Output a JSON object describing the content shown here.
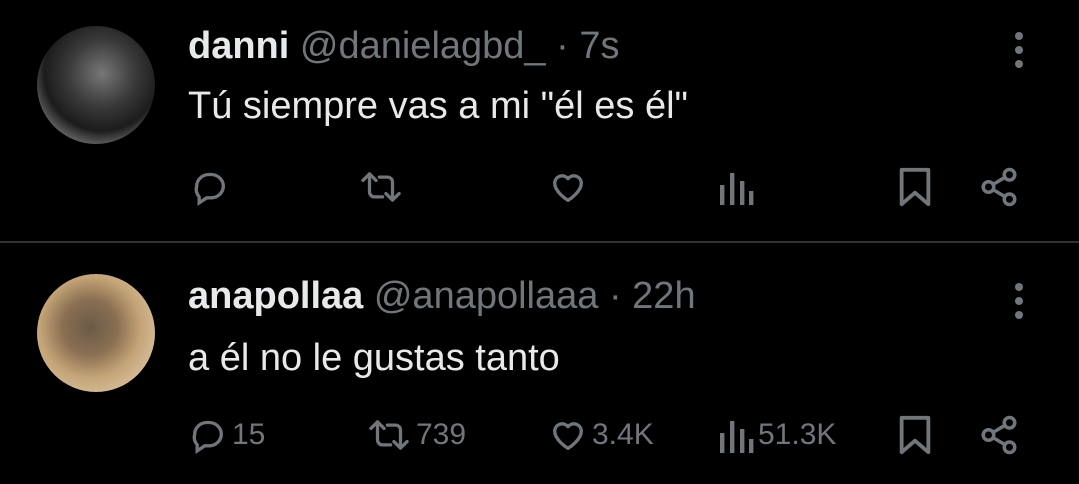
{
  "tweets": [
    {
      "display_name": "danni",
      "handle": "@danielagbd_",
      "separator": "·",
      "time": "7s",
      "text": "Tú siempre vas a mi \"él es él\"",
      "stats": {
        "replies": "",
        "reposts": "",
        "likes": "",
        "views": ""
      },
      "avatar_icon": "profile-photo"
    },
    {
      "display_name": "anapollaa",
      "handle": "@anapollaaa",
      "separator": "·",
      "time": "22h",
      "text": "a él no le gustas tanto",
      "stats": {
        "replies": "15",
        "reposts": "739",
        "likes": "3.4K",
        "views": "51.3K"
      },
      "avatar_icon": "profile-photo"
    }
  ],
  "icons": [
    "reply-icon",
    "repost-icon",
    "like-icon",
    "views-icon",
    "bookmark-icon",
    "share-icon",
    "more-icon"
  ],
  "colors": {
    "background": "#000000",
    "text": "#e7e9ea",
    "muted": "#71767b",
    "divider": "#2f3336"
  }
}
